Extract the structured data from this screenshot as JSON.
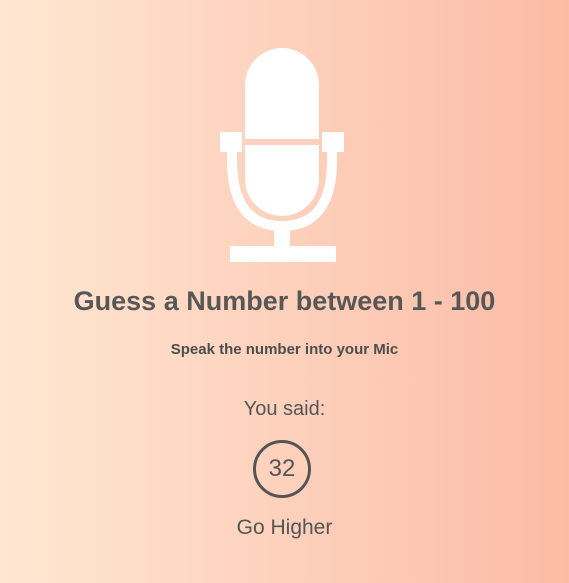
{
  "game": {
    "title": "Guess a Number between 1 - 100",
    "instruction": "Speak the number into your Mic",
    "you_said_label": "You said:",
    "spoken_number": "32",
    "hint": "Go Higher"
  },
  "icons": {
    "main": "microphone-icon"
  },
  "colors": {
    "gradient_start": "#ffe7d2",
    "gradient_end": "#fcbba5",
    "text": "#555555",
    "icon": "#ffffff"
  }
}
